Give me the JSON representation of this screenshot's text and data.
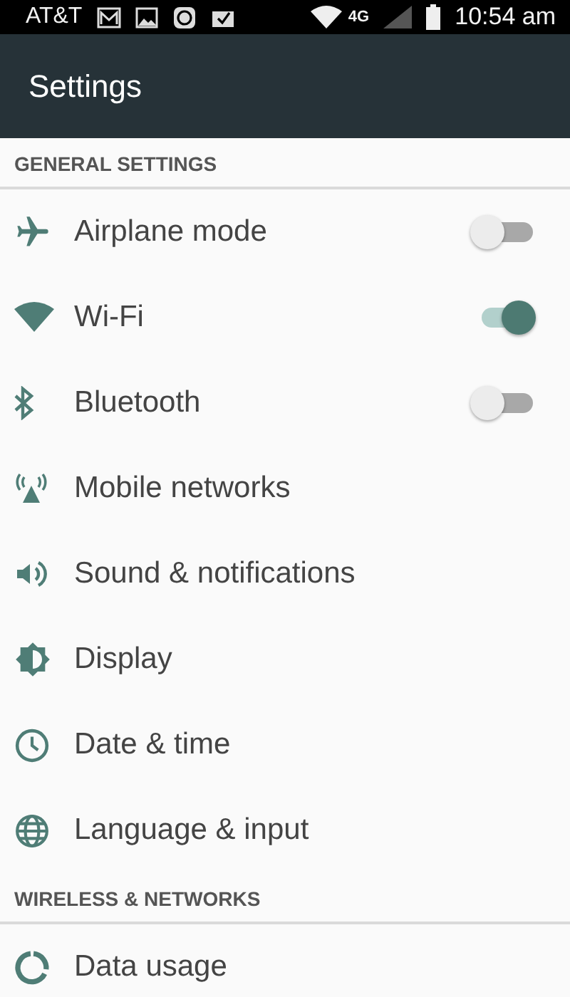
{
  "status_bar": {
    "carrier": "AT&T",
    "network": "4G",
    "time": "10:54 am"
  },
  "app_bar": {
    "title": "Settings"
  },
  "sections": [
    {
      "header": "GENERAL SETTINGS",
      "items": [
        {
          "label": "Airplane mode",
          "kind": "toggle",
          "on": false
        },
        {
          "label": "Wi-Fi",
          "kind": "toggle",
          "on": true
        },
        {
          "label": "Bluetooth",
          "kind": "toggle",
          "on": false
        },
        {
          "label": "Mobile networks",
          "kind": "link"
        },
        {
          "label": "Sound & notifications",
          "kind": "link"
        },
        {
          "label": "Display",
          "kind": "link"
        },
        {
          "label": "Date & time",
          "kind": "link"
        },
        {
          "label": "Language & input",
          "kind": "link"
        }
      ]
    },
    {
      "header": "WIRELESS & NETWORKS",
      "items": [
        {
          "label": "Data usage",
          "kind": "link"
        }
      ]
    }
  ]
}
